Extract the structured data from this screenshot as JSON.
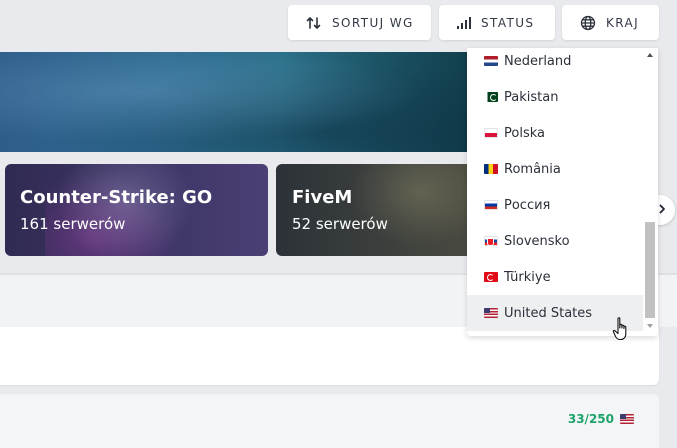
{
  "toolbar": {
    "sort_label": "SORTUJ WG",
    "status_label": "STATUS",
    "country_label": "KRAJ"
  },
  "games": [
    {
      "name": "Counter-Strike: GO",
      "servers": "161 serwerów"
    },
    {
      "name": "FiveM",
      "servers": "52 serwerów"
    }
  ],
  "country_dropdown": {
    "items": [
      {
        "label": "Nederland",
        "flag": "flag-nl"
      },
      {
        "label": "Pakistan",
        "flag": "flag-pk"
      },
      {
        "label": "Polska",
        "flag": "flag-pl"
      },
      {
        "label": "România",
        "flag": "flag-ro"
      },
      {
        "label": "Россия",
        "flag": "flag-ru"
      },
      {
        "label": "Slovensko",
        "flag": "flag-sk"
      },
      {
        "label": "Türkiye",
        "flag": "flag-tr"
      },
      {
        "label": "United States",
        "flag": "flag-us"
      }
    ],
    "hovered_item": "United States"
  },
  "server_row": {
    "player_count": "33/250",
    "flag": "flag-us",
    "count_color": "#1ea36a"
  },
  "icons": {
    "sort": "sort-arrows-icon",
    "status": "signal-bars-icon",
    "country": "globe-icon",
    "next": "chevron-right-icon"
  }
}
